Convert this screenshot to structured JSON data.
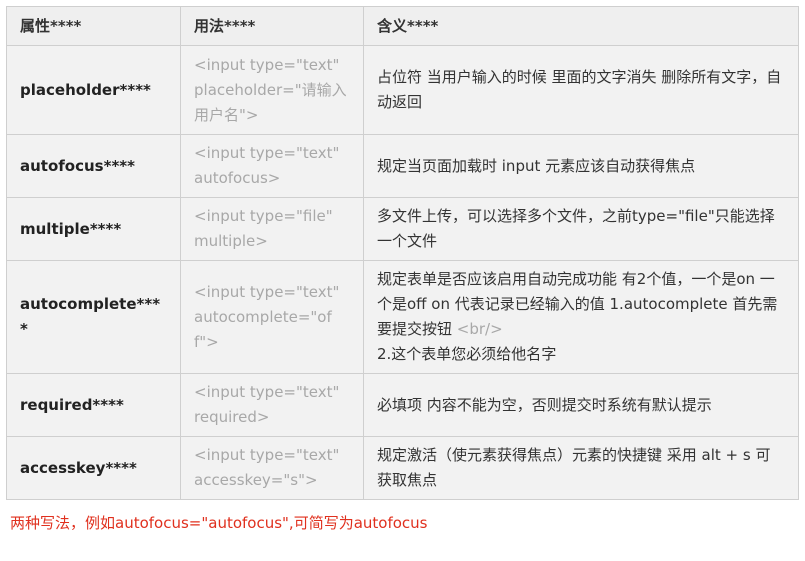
{
  "table": {
    "headers": [
      "属性****",
      "用法****",
      "含义****"
    ],
    "rows": [
      {
        "name": "placeholder****",
        "usage": "<input type=\"text\" placeholder=\"请输入用户名\">",
        "meaning": "占位符  当用户输入的时候 里面的文字消失  删除所有文字，自动返回"
      },
      {
        "name": "autofocus****",
        "usage": "<input type=\"text\" autofocus>",
        "meaning": "规定当页面加载时 input 元素应该自动获得焦点"
      },
      {
        "name": "multiple****",
        "usage": "<input type=\"file\" multiple>",
        "meaning": "多文件上传，可以选择多个文件，之前type=\"file\"只能选择一个文件"
      },
      {
        "name": "autocomplete****",
        "usage": "<input type=\"text\" autocomplete=\"off\">",
        "meaning": "规定表单是否应该启用自动完成功能  有2个值，一个是on 一个是off      on 代表记录已经输入的值  1.autocomplete 首先需要提交按钮",
        "meaning_tag": "<br/>",
        "meaning_line2": "2.这个表单您必须给他名字"
      },
      {
        "name": "required****",
        "usage": "<input type=\"text\" required>",
        "meaning": "必填项  内容不能为空，否则提交时系统有默认提示"
      },
      {
        "name": "accesskey****",
        "usage": "<input type=\"text\" accesskey=\"s\">",
        "meaning": "规定激活（使元素获得焦点）元素的快捷键   采用 alt + s 可获取焦点"
      }
    ]
  },
  "note": "两种写法，例如autofocus=\"autofocus\",可简写为autofocus",
  "colors": {
    "header_bg": "#efefef",
    "row_bg": "#f2f2f2",
    "border": "#cfcfcf",
    "usage_text": "#a8a8a8",
    "note_text": "#e0301e"
  }
}
